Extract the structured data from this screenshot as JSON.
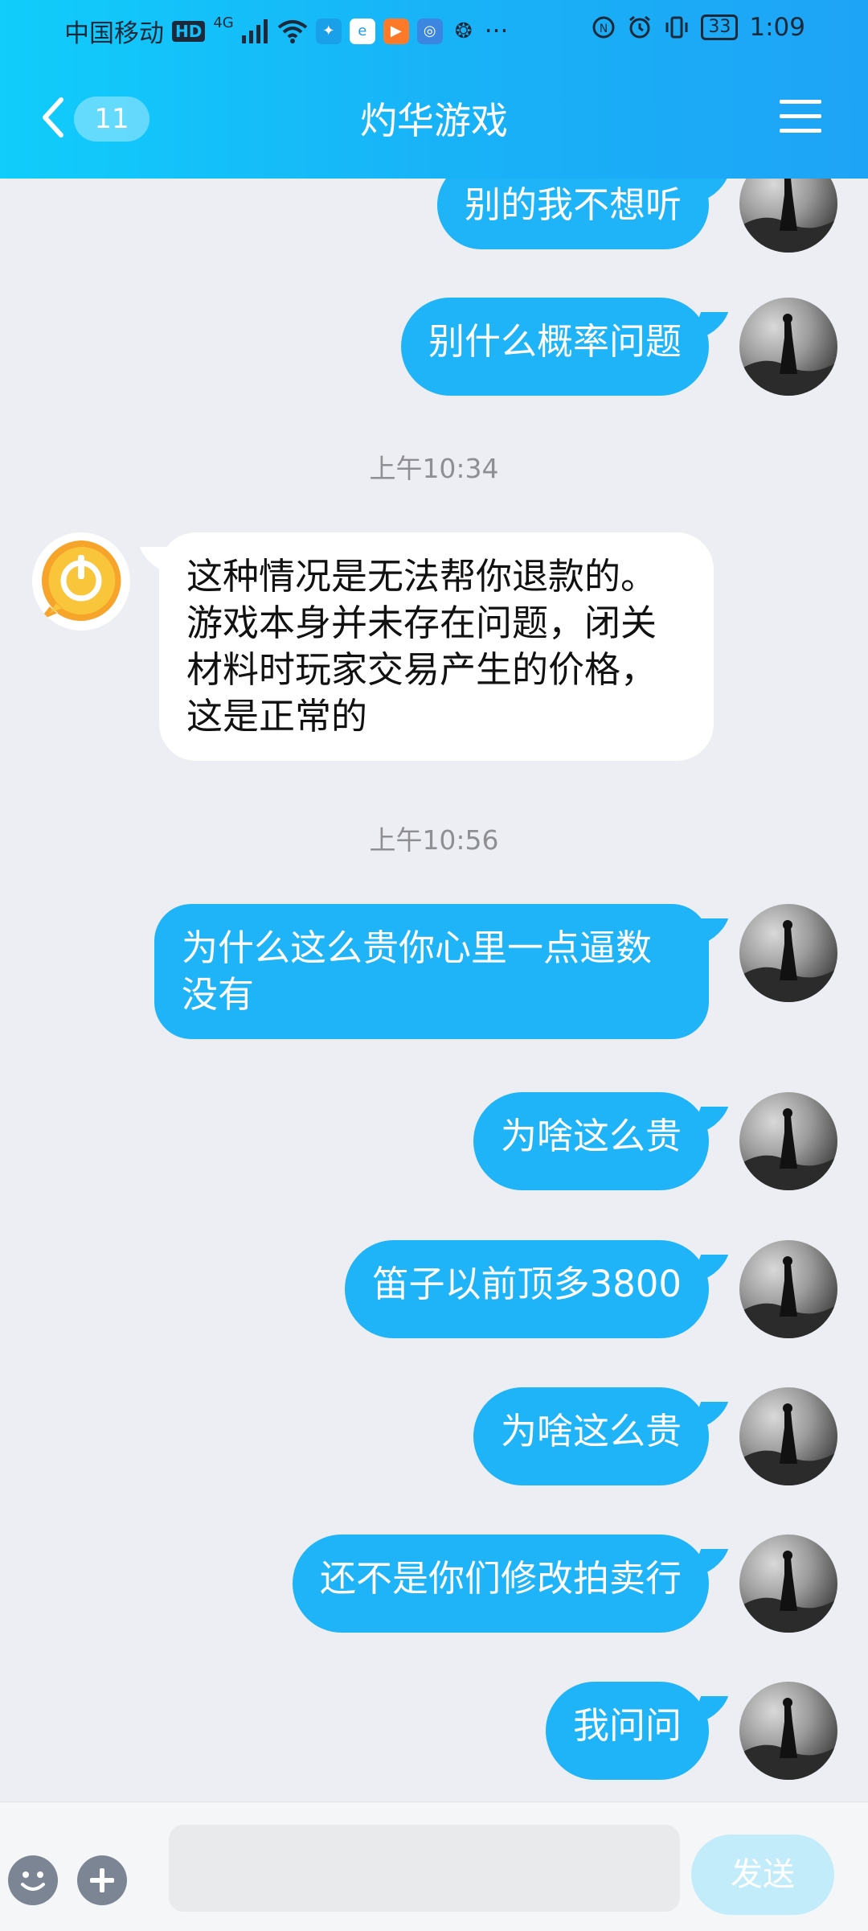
{
  "status_bar": {
    "carrier": "中国移动",
    "hd_badge": "HD",
    "network": "4G",
    "battery": "33",
    "time": "1:09",
    "more": "···"
  },
  "header": {
    "unread_count": "11",
    "title": "灼华游戏"
  },
  "messages": [
    {
      "side": "out",
      "text": "别的我不想听"
    },
    {
      "side": "out",
      "text": "别什么概率问题"
    },
    {
      "type": "time",
      "text": "上午10:34"
    },
    {
      "side": "in",
      "text": "这种情况是无法帮你退款的。游戏本身并未存在问题，闭关材料时玩家交易产生的价格，这是正常的"
    },
    {
      "type": "time",
      "text": "上午10:56"
    },
    {
      "side": "out",
      "text": "为什么这么贵你心里一点逼数没有"
    },
    {
      "side": "out",
      "text": "为啥这么贵"
    },
    {
      "side": "out",
      "text": "笛子以前顶多3800"
    },
    {
      "side": "out",
      "text": "为啥这么贵"
    },
    {
      "side": "out",
      "text": "还不是你们修改拍卖行"
    },
    {
      "side": "out",
      "text": "我问问"
    }
  ],
  "input_bar": {
    "placeholder": "",
    "send_label": "发送"
  },
  "colors": {
    "header_gradient_start": "#10cdfb",
    "header_gradient_end": "#1ea4f6",
    "outgoing_bubble": "#1eb4f7",
    "incoming_bubble": "#ffffff",
    "chat_background": "#eceef3",
    "send_button_disabled": "#c3ecfb"
  }
}
